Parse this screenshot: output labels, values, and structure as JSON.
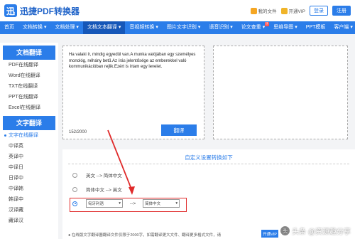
{
  "header": {
    "logo_mark": "迅",
    "app_title": "迅捷PDF转换器",
    "links": [
      "我的文件",
      "开通VIP",
      "登录",
      "注册"
    ]
  },
  "nav": {
    "items": [
      "首页",
      "文档转换",
      "文档处理",
      "文档文本翻译",
      "音视频转换",
      "图片文字识别",
      "语音识别",
      "论文查重",
      "思维导图",
      "PPT模板",
      "客户端"
    ],
    "active_index": 3,
    "hot_badge": "热",
    "hot_index": 7
  },
  "sidebar": {
    "doc_head": "文档翻译",
    "doc_items": [
      "PDF在线翻译",
      "Word在线翻译",
      "TXT在线翻译",
      "PPT在线翻译",
      "Excel在线翻译"
    ],
    "text_head": "文字翻译",
    "text_items": [
      "文字在线翻译",
      "中译英",
      "英译中",
      "中译日",
      "日译中",
      "中译韩",
      "韩译中",
      "汉译藏",
      "藏译汉"
    ],
    "active_text_index": 0
  },
  "editor": {
    "source_text": "Ha valaki ír, mindig egyedül van.A munka valójában egy személyes monológ, néhány betű.Az írás jelentősége az emberekkel való kommunikációban rejlik.Ezért is írtam egy levelet.",
    "char_count": "152/2000",
    "translate_label": "翻译"
  },
  "custom": {
    "title": "自定义设置转换如下",
    "option1": "英文 --> 简体中文",
    "option2": "简体中文 --> 英文",
    "from_select": "匈牙利语",
    "arrow": "-->",
    "to_select": "简体中文",
    "selected_option": 3
  },
  "note": {
    "text": "● 在线版文字翻译器翻译文件仅限于2000字，如需翻译更大文件、翻译更多格式文件，请",
    "button": "开通VIP"
  },
  "watermark": {
    "icon": "头",
    "text": "头条 @资源趣分享"
  },
  "colors": {
    "accent": "#2b7de9",
    "highlight": "#e02a2a"
  }
}
